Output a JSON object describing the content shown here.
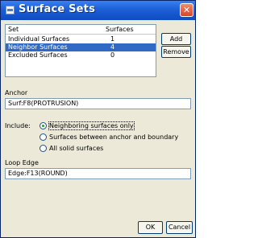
{
  "window": {
    "title": "Surface Sets",
    "close_glyph": "✕"
  },
  "sets_list": {
    "columns": [
      "Set",
      "Surfaces"
    ],
    "rows": [
      {
        "set": "Individual Surfaces",
        "surfaces": "1"
      },
      {
        "set": "Neighbor Surfaces",
        "surfaces": "4"
      },
      {
        "set": "Excluded Surfaces",
        "surfaces": "0"
      }
    ],
    "selected_index": 1
  },
  "buttons": {
    "add": "Add",
    "remove": "Remove",
    "ok": "OK",
    "cancel": "Cancel"
  },
  "anchor": {
    "label": "Anchor",
    "value": "Surf:F8(PROTRUSION)"
  },
  "include": {
    "label": "Include:",
    "options": [
      "Neighboring surfaces only",
      "Surfaces between anchor and boundary",
      "All solid surfaces"
    ],
    "selected_index": 0
  },
  "loop_edge": {
    "label": "Loop Edge",
    "value": "Edge:F13(ROUND)"
  }
}
